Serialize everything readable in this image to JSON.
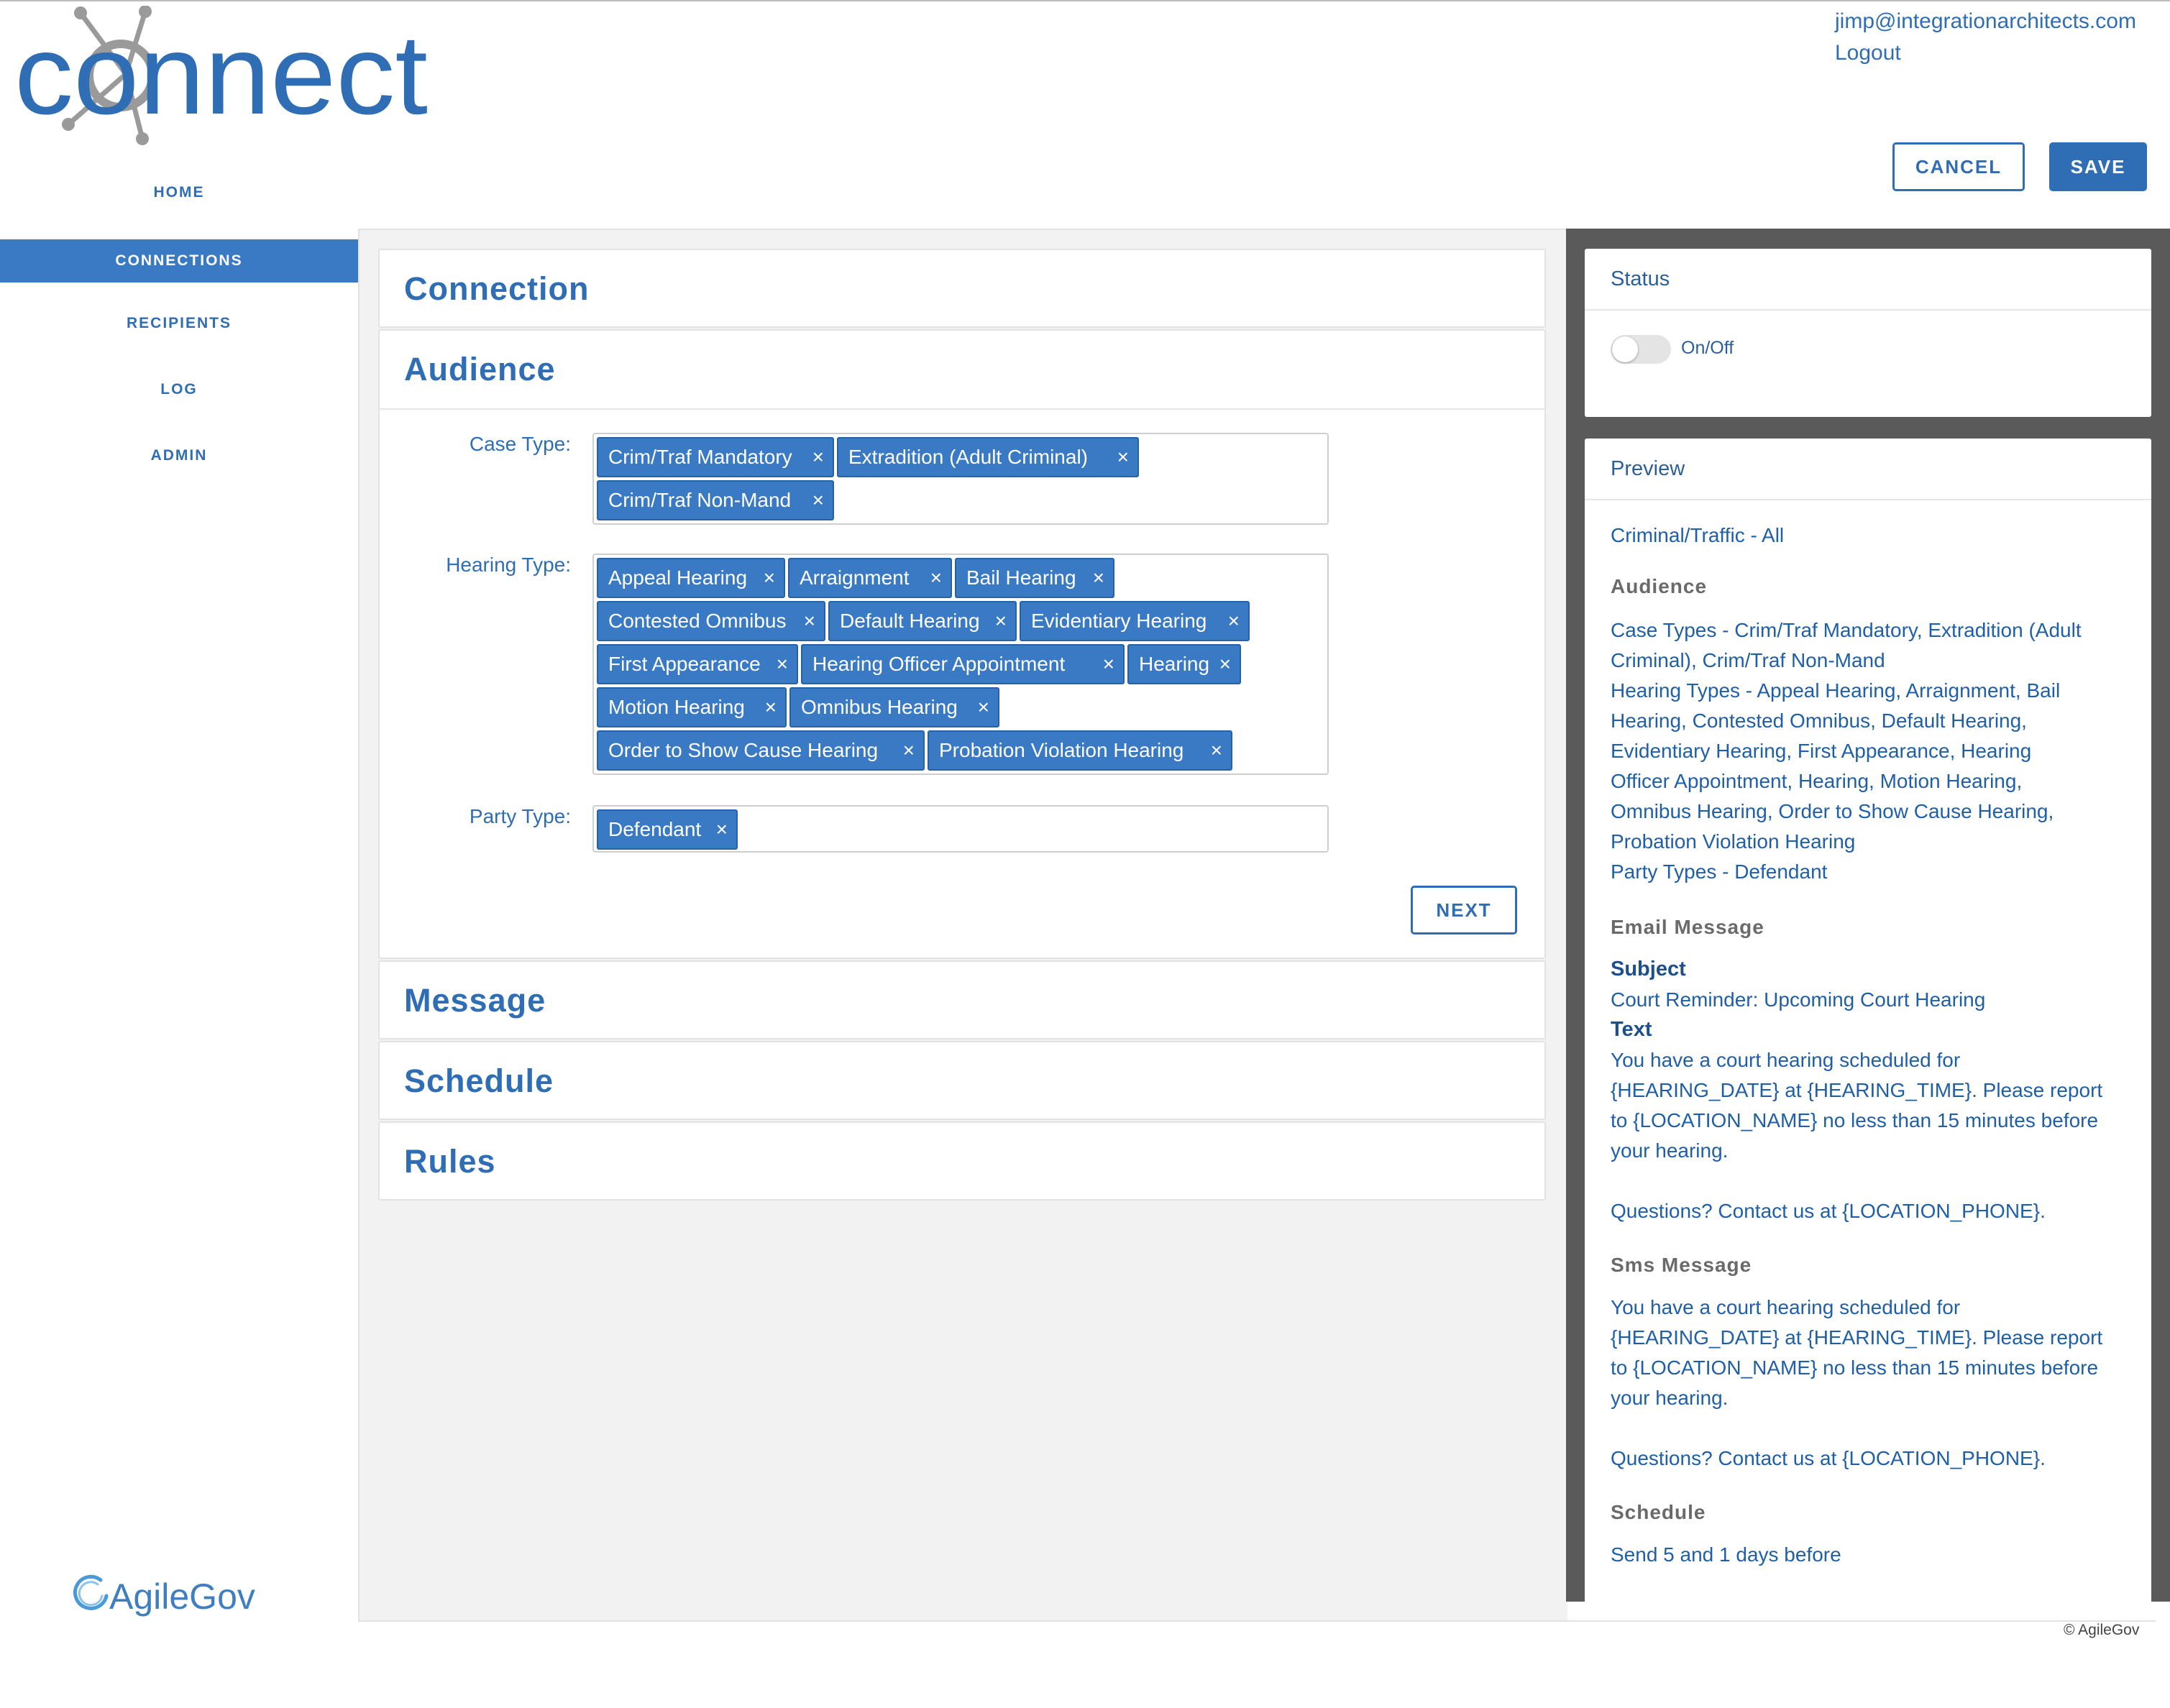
{
  "header": {
    "logo_text": "connect",
    "user_email": "jimp@integrationarchitects.com",
    "logout_label": "Logout",
    "cancel_label": "CANCEL",
    "save_label": "SAVE"
  },
  "colors": {
    "accent": "#2f6db5",
    "chip": "#3a79c4",
    "right_panel_bg": "#5a5a5a",
    "logo_gray": "#9a9a9a"
  },
  "nav": {
    "items": [
      {
        "label": "HOME"
      },
      {
        "label": "CONNECTIONS"
      },
      {
        "label": "RECIPIENTS"
      },
      {
        "label": "LOG"
      },
      {
        "label": "ADMIN"
      }
    ],
    "active": "CONNECTIONS",
    "footer_logo": "AgileGov"
  },
  "sections": {
    "connection": "Connection",
    "audience": "Audience",
    "message": "Message",
    "schedule": "Schedule",
    "rules": "Rules"
  },
  "audience": {
    "case_type_label": "Case Type:",
    "hearing_type_label": "Hearing Type:",
    "party_type_label": "Party Type:",
    "case_types": [
      "Crim/Traf Mandatory",
      "Extradition (Adult Criminal)",
      "Crim/Traf Non-Mand"
    ],
    "hearing_types": [
      "Appeal Hearing",
      "Arraignment",
      "Bail Hearing",
      "Contested Omnibus",
      "Default Hearing",
      "Evidentiary Hearing",
      "First Appearance",
      "Hearing Officer Appointment",
      "Hearing",
      "Motion Hearing",
      "Omnibus Hearing",
      "Order to Show Cause Hearing",
      "Probation Violation Hearing"
    ],
    "party_types": [
      "Defendant"
    ],
    "remove_glyph": "×",
    "next_label": "NEXT"
  },
  "status": {
    "title": "Status",
    "toggle_label": "On/Off",
    "toggle_on": false
  },
  "preview": {
    "title": "Preview",
    "connection_name": "Criminal/Traffic - All",
    "audience_heading": "Audience",
    "case_types_line1": "Case Types - Crim/Traf Mandatory, Extradition (Adult",
    "case_types_line2": "Criminal), Crim/Traf Non-Mand",
    "hearing_line1": "Hearing Types - Appeal Hearing, Arraignment, Bail",
    "hearing_line2": "Hearing, Contested Omnibus, Default Hearing,",
    "hearing_line3": "Evidentiary Hearing, First Appearance, Hearing",
    "hearing_line4": "Officer Appointment, Hearing, Motion Hearing,",
    "hearing_line5": "Omnibus Hearing, Order to Show Cause Hearing,",
    "hearing_line6": "Probation Violation Hearing",
    "party_line": "Party Types - Defendant",
    "email_heading": "Email Message",
    "subject_label": "Subject",
    "subject_value": "Court Reminder: Upcoming Court Hearing",
    "text_label": "Text",
    "email_line1": "You have a court hearing scheduled for",
    "email_line2": "{HEARING_DATE} at {HEARING_TIME}. Please report",
    "email_line3": "to {LOCATION_NAME} no less than 15 minutes before",
    "email_line4": "your hearing.",
    "email_line5": "Questions? Contact us at {LOCATION_PHONE}.",
    "sms_heading": "Sms Message",
    "sms_line1": "You have a court hearing scheduled for",
    "sms_line2": "{HEARING_DATE} at {HEARING_TIME}. Please report",
    "sms_line3": "to {LOCATION_NAME} no less than 15 minutes before",
    "sms_line4": "your hearing.",
    "sms_line5": "Questions? Contact us at {LOCATION_PHONE}.",
    "schedule_heading": "Schedule",
    "schedule_value": "Send 5 and 1 days before"
  },
  "footer": {
    "copyright": "© AgileGov"
  }
}
